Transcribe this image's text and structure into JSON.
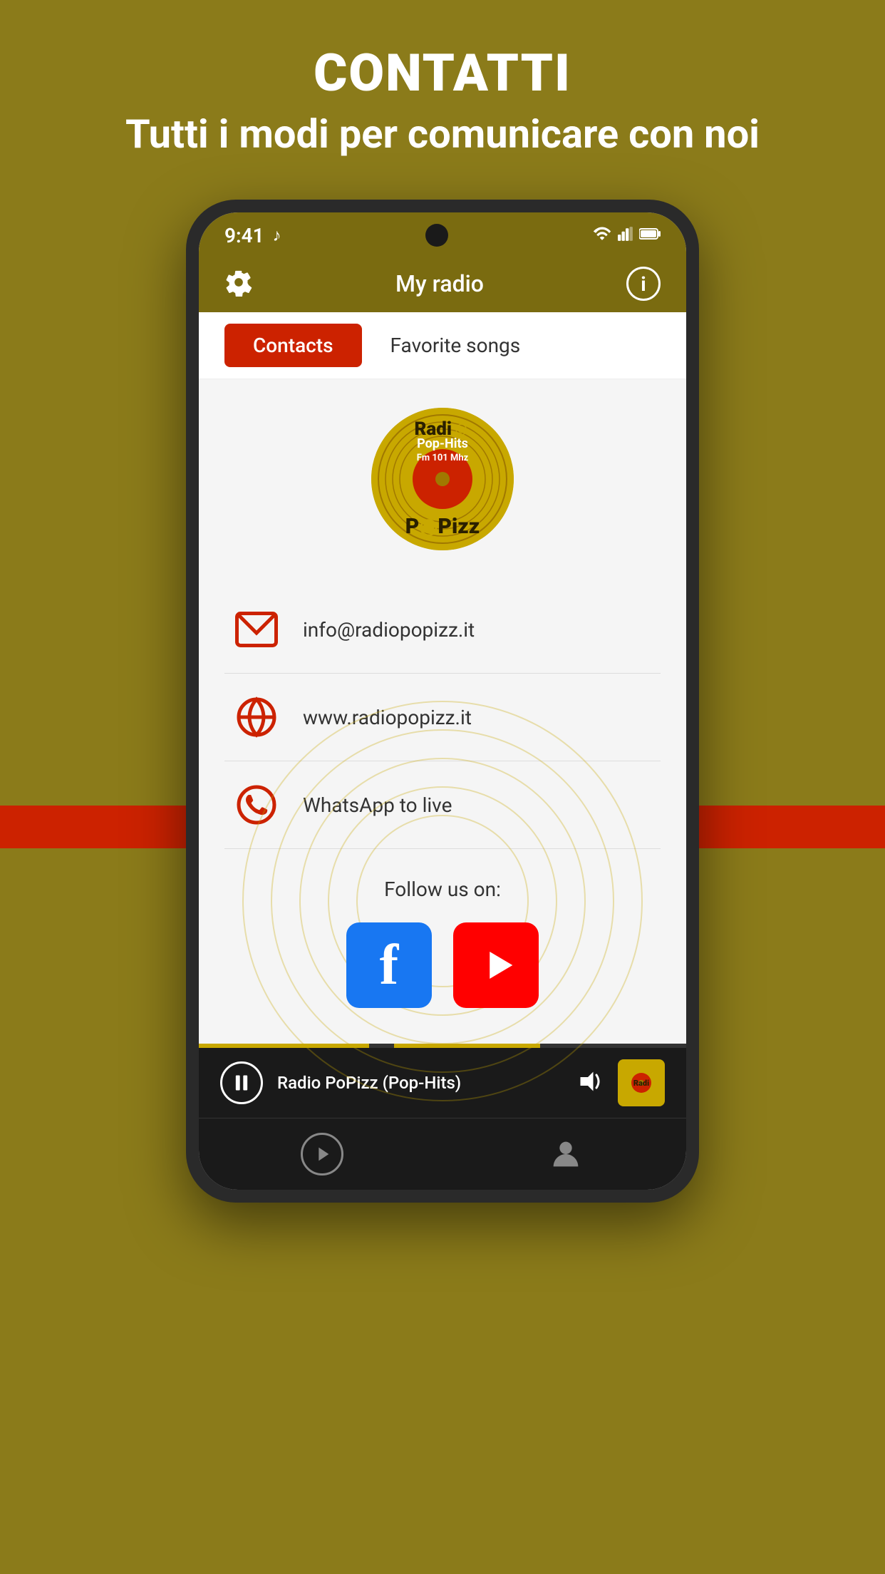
{
  "page": {
    "background_color": "#8B7B1A",
    "title": "CONTATTI",
    "subtitle": "Tutti i modi per comunicare con noi"
  },
  "status_bar": {
    "time": "9:41",
    "music_note": "♪"
  },
  "app_bar": {
    "title": "My radio",
    "settings_label": "Settings",
    "info_label": "Info"
  },
  "tabs": {
    "contacts_label": "Contacts",
    "favorite_songs_label": "Favorite songs"
  },
  "radio_logo": {
    "text_top": "Radio",
    "text_bottom": "PoPizz",
    "subtext": "Pop-Hits"
  },
  "contacts": [
    {
      "icon_name": "email-icon",
      "text": "info@radiopopizz.it"
    },
    {
      "icon_name": "globe-icon",
      "text": "www.radiopopizz.it"
    },
    {
      "icon_name": "whatsapp-icon",
      "text": "WhatsApp to live"
    }
  ],
  "follow_section": {
    "label": "Follow us on:",
    "facebook_label": "Facebook",
    "youtube_label": "YouTube"
  },
  "player": {
    "track_name": "Radio PoPizz (Pop-Hits)",
    "pause_label": "Pause",
    "volume_label": "Volume"
  },
  "bottom_nav": {
    "play_label": "Play",
    "profile_label": "Profile"
  }
}
